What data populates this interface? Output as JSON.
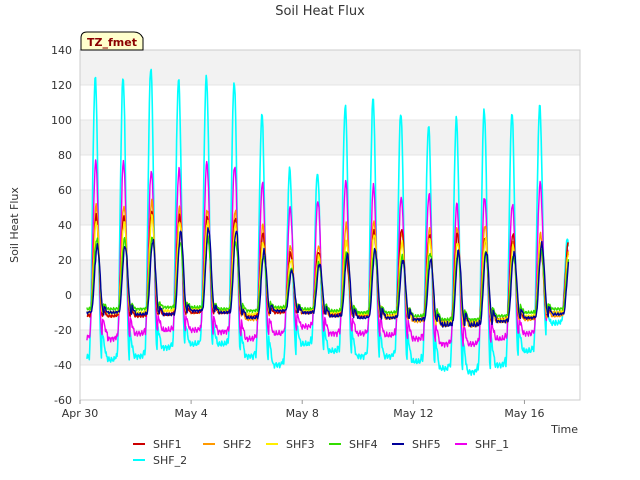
{
  "chart_data": {
    "type": "line",
    "title": "Soil Heat Flux",
    "xlabel": "Time",
    "ylabel": "Soil Heat Flux",
    "badge": "TZ_fmet",
    "ylim": [
      -60,
      140
    ],
    "yticks": [
      -60,
      -40,
      -20,
      0,
      20,
      40,
      60,
      80,
      100,
      120,
      140
    ],
    "xlim": [
      "2024-04-30",
      "2024-05-18"
    ],
    "xticks": [
      {
        "date": "2024-04-30",
        "label": "Apr 30"
      },
      {
        "date": "2024-05-04",
        "label": "May 4"
      },
      {
        "date": "2024-05-08",
        "label": "May 8"
      },
      {
        "date": "2024-05-12",
        "label": "May 12"
      },
      {
        "date": "2024-05-16",
        "label": "May 16"
      }
    ],
    "grid": "horizontal bands",
    "legend_position": "bottom",
    "days": [
      "2024-05-01",
      "2024-05-02",
      "2024-05-03",
      "2024-05-04",
      "2024-05-05",
      "2024-05-06",
      "2024-05-07",
      "2024-05-08",
      "2024-05-09",
      "2024-05-10",
      "2024-05-11",
      "2024-05-12",
      "2024-05-13",
      "2024-05-14",
      "2024-05-15",
      "2024-05-16",
      "2024-05-17"
    ],
    "series": [
      {
        "name": "SHF1",
        "color": "#cc0000",
        "daily_max": [
          45,
          48,
          45,
          45,
          44,
          35,
          24,
          25,
          22,
          36,
          38,
          34,
          35,
          32,
          35,
          28,
          30
        ],
        "daily_min": [
          -12,
          -12,
          -11,
          -10,
          -10,
          -12,
          -10,
          -10,
          -11,
          -12,
          -12,
          -14,
          -15,
          -15,
          -14,
          -13,
          -10
        ]
      },
      {
        "name": "SHF2",
        "color": "#ff9900",
        "daily_max": [
          51,
          54,
          50,
          49,
          48,
          40,
          28,
          28,
          40,
          42,
          36,
          38,
          38,
          40,
          30,
          35,
          30
        ],
        "daily_min": [
          -12,
          -12,
          -11,
          -10,
          -10,
          -14,
          -10,
          -10,
          -12,
          -12,
          -13,
          -15,
          -17,
          -17,
          -15,
          -14,
          -12
        ]
      },
      {
        "name": "SHF3",
        "color": "#ffee00",
        "daily_max": [
          42,
          45,
          42,
          42,
          40,
          30,
          20,
          22,
          30,
          35,
          30,
          32,
          30,
          32,
          28,
          30,
          25
        ],
        "daily_min": [
          -10,
          -10,
          -9,
          -8,
          -9,
          -11,
          -8,
          -9,
          -10,
          -11,
          -12,
          -14,
          -16,
          -16,
          -14,
          -12,
          -10
        ]
      },
      {
        "name": "SHF4",
        "color": "#33dd00",
        "daily_max": [
          32,
          33,
          30,
          32,
          30,
          22,
          15,
          18,
          25,
          26,
          22,
          24,
          24,
          24,
          22,
          25,
          20
        ],
        "daily_min": [
          -8,
          -8,
          -7,
          -7,
          -8,
          -9,
          -7,
          -8,
          -9,
          -10,
          -10,
          -12,
          -14,
          -14,
          -12,
          -10,
          -8
        ]
      },
      {
        "name": "SHF5",
        "color": "#000099",
        "daily_max": [
          28,
          31,
          36,
          38,
          37,
          25,
          14,
          18,
          23,
          26,
          20,
          20,
          25,
          25,
          24,
          29,
          20
        ],
        "daily_min": [
          -10,
          -11,
          -11,
          -9,
          -10,
          -13,
          -9,
          -10,
          -12,
          -13,
          -13,
          -14,
          -17,
          -17,
          -15,
          -13,
          -11
        ]
      },
      {
        "name": "SHF_1",
        "color": "#ee00ee",
        "daily_max": [
          76,
          71,
          72,
          76,
          74,
          64,
          50,
          54,
          65,
          62,
          56,
          58,
          52,
          56,
          52,
          64,
          25
        ],
        "daily_min": [
          -25,
          -22,
          -20,
          -20,
          -21,
          -25,
          -22,
          -18,
          -22,
          -22,
          -23,
          -25,
          -28,
          -28,
          -25,
          -22,
          -10
        ]
      },
      {
        "name": "SHF_2",
        "color": "#00ffff",
        "daily_max": [
          124,
          130,
          123,
          125,
          122,
          103,
          72,
          70,
          108,
          112,
          104,
          97,
          101,
          106,
          104,
          108,
          32
        ],
        "daily_min": [
          -37,
          -35,
          -30,
          -28,
          -28,
          -35,
          -40,
          -28,
          -32,
          -35,
          -35,
          -38,
          -42,
          -44,
          -40,
          -32,
          -16
        ]
      }
    ]
  }
}
